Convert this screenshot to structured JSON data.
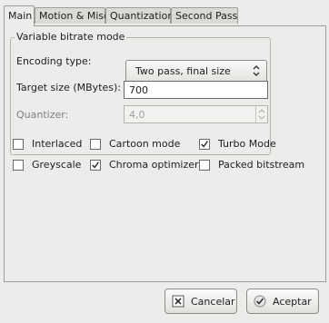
{
  "tabs": [
    {
      "label": "Main",
      "active": true
    },
    {
      "label": "Motion & Misc",
      "active": false
    },
    {
      "label": "Quantization",
      "active": false
    },
    {
      "label": "Second Pass",
      "active": false
    }
  ],
  "bitrate": {
    "title": "Variable bitrate mode",
    "encoding_label": "Encoding type:",
    "encoding_value": "Two pass, final size",
    "target_label": "Target size (MBytes):",
    "target_value": "700",
    "quantizer_label": "Quantizer:",
    "quantizer_value": "4,0"
  },
  "options": {
    "interlaced": {
      "label": "Interlaced",
      "checked": false
    },
    "cartoon": {
      "label": "Cartoon mode",
      "checked": false
    },
    "turbo": {
      "label": "Turbo Mode",
      "checked": true
    },
    "greyscale": {
      "label": "Greyscale",
      "checked": false
    },
    "chroma": {
      "label": "Chroma optimizer",
      "checked": true
    },
    "packed": {
      "label": "Packed bitstream",
      "checked": false
    }
  },
  "buttons": {
    "cancel": "Cancelar",
    "accept": "Aceptar"
  },
  "icons": {
    "combo": "updown-arrows-icon",
    "cancel": "close-icon",
    "accept": "checkmark-icon"
  }
}
